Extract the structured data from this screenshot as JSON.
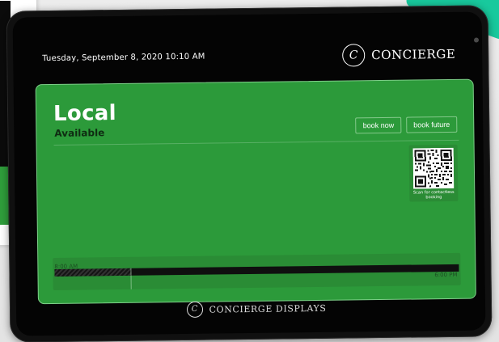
{
  "header": {
    "datetime": "Tuesday, September 8, 2020 10:10 AM",
    "brand": "CONCIERGE",
    "logo_letter": "C",
    "logo_icon": "concierge-logo"
  },
  "room": {
    "name": "Local",
    "status": "Available",
    "status_color": "#0f2c12",
    "panel_color": "#2c9a3a"
  },
  "actions": {
    "book_now": "book now",
    "book_future": "book future"
  },
  "qr": {
    "label": "Scan for contactless booking"
  },
  "timeline": {
    "start": "8:00 AM",
    "end": "6:00 PM",
    "busy_progress": 0.19
  },
  "footer": {
    "brand": "CONCIERGE DISPLAYS",
    "logo_letter": "C",
    "logo_icon": "concierge-logo"
  }
}
